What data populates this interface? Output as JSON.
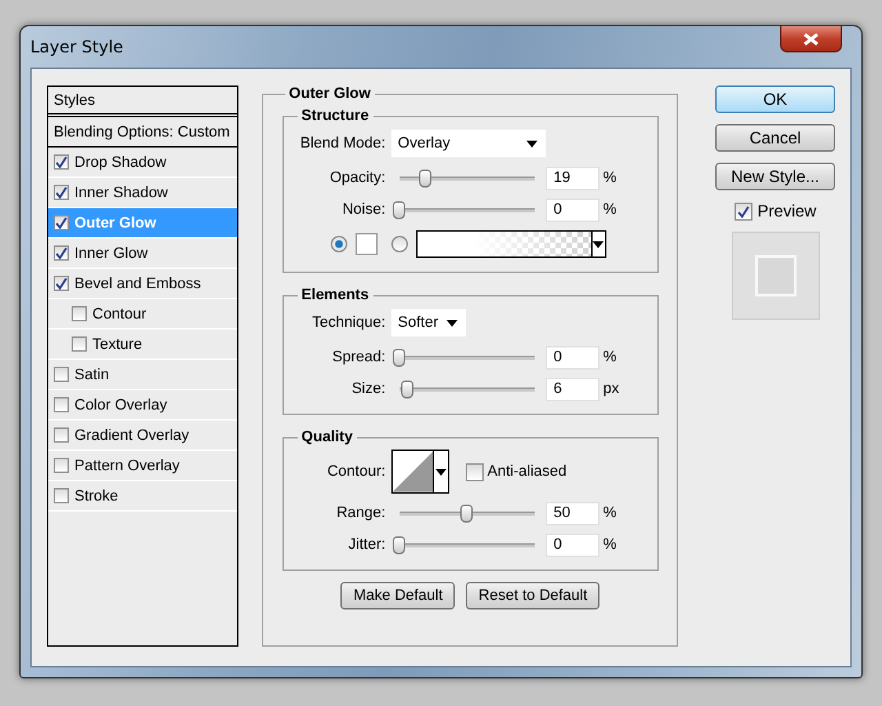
{
  "window": {
    "title": "Layer Style"
  },
  "styles_header": "Styles",
  "blending_options": "Blending Options: Custom",
  "styles": [
    {
      "label": "Drop Shadow",
      "checked": true,
      "selected": false
    },
    {
      "label": "Inner Shadow",
      "checked": true,
      "selected": false
    },
    {
      "label": "Outer Glow",
      "checked": true,
      "selected": true
    },
    {
      "label": "Inner Glow",
      "checked": true,
      "selected": false
    },
    {
      "label": "Bevel and Emboss",
      "checked": true,
      "selected": false,
      "children": [
        {
          "label": "Contour",
          "checked": false,
          "selected": false
        },
        {
          "label": "Texture",
          "checked": false,
          "selected": false
        }
      ]
    },
    {
      "label": "Satin",
      "checked": false,
      "selected": false
    },
    {
      "label": "Color Overlay",
      "checked": false,
      "selected": false
    },
    {
      "label": "Gradient Overlay",
      "checked": false,
      "selected": false
    },
    {
      "label": "Pattern Overlay",
      "checked": false,
      "selected": false
    },
    {
      "label": "Stroke",
      "checked": false,
      "selected": false
    }
  ],
  "panel": {
    "title": "Outer Glow",
    "structure": {
      "title": "Structure",
      "blend_mode": {
        "label": "Blend Mode:",
        "value": "Overlay"
      },
      "sliders": [
        {
          "label": "Opacity:",
          "level": 0.19,
          "value": "19",
          "unit": "%"
        },
        {
          "label": "Noise:",
          "level": 0,
          "value": "0",
          "unit": "%"
        }
      ],
      "fill_options": [
        {
          "kind": "color",
          "selected": true
        },
        {
          "kind": "gradient",
          "selected": false
        }
      ]
    },
    "elements": {
      "title": "Elements",
      "technique": {
        "label": "Technique:",
        "value": "Softer"
      },
      "sliders": [
        {
          "label": "Spread:",
          "level": 0,
          "value": "0",
          "unit": "%"
        },
        {
          "label": "Size:",
          "level": 0.06,
          "value": "6",
          "unit": "px"
        }
      ]
    },
    "quality": {
      "title": "Quality",
      "contour_label": "Contour:",
      "anti_aliased": {
        "label": "Anti-aliased",
        "checked": false
      },
      "sliders": [
        {
          "label": "Range:",
          "level": 0.5,
          "value": "50",
          "unit": "%"
        },
        {
          "label": "Jitter:",
          "level": 0,
          "value": "0",
          "unit": "%"
        }
      ]
    },
    "buttons": [
      "Make Default",
      "Reset to Default"
    ]
  },
  "actions": [
    {
      "label": "OK",
      "kind": "default"
    },
    {
      "label": "Cancel",
      "kind": "normal"
    },
    {
      "label": "New Style...",
      "kind": "normal"
    }
  ],
  "preview": {
    "label": "Preview",
    "checked": true
  }
}
